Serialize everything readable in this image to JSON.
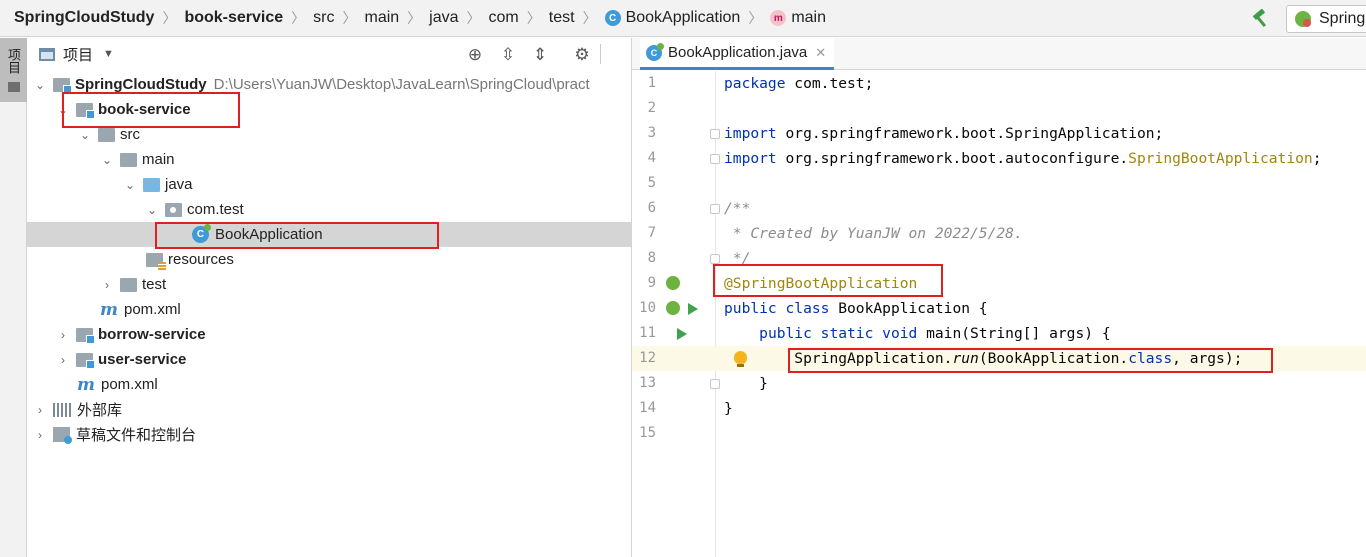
{
  "breadcrumb": {
    "items": [
      "SpringCloudStudy",
      "book-service",
      "src",
      "main",
      "java",
      "com",
      "test",
      "BookApplication",
      "main"
    ],
    "class_badge": "C",
    "method_badge": "m"
  },
  "toolbar": {
    "run_config_label": "Spring"
  },
  "tool_strip": {
    "project_tab": "项目"
  },
  "project_panel": {
    "title": "项目",
    "tree": {
      "root_label": "SpringCloudStudy",
      "root_path": "D:\\Users\\YuanJW\\Desktop\\JavaLearn\\SpringCloud\\pract",
      "book_service": "book-service",
      "src": "src",
      "main": "main",
      "java": "java",
      "com_test": "com.test",
      "book_application": "BookApplication",
      "resources": "resources",
      "test": "test",
      "pom_book": "pom.xml",
      "borrow_service": "borrow-service",
      "user_service": "user-service",
      "pom_root": "pom.xml",
      "external_libs": "外部库",
      "scratches": "草稿文件和控制台",
      "maven_badge": "m"
    }
  },
  "editor": {
    "tab_label": "BookApplication.java",
    "line_numbers": [
      "1",
      "2",
      "3",
      "4",
      "5",
      "6",
      "7",
      "8",
      "9",
      "10",
      "11",
      "12",
      "13",
      "14",
      "15"
    ],
    "code": {
      "l1_kw": "package",
      "l1_rest": " com.test;",
      "l3_kw": "import",
      "l3_rest": " org.springframework.boot.SpringApplication;",
      "l4_kw": "import",
      "l4_rest": " org.springframework.boot.autoconfigure.",
      "l4_ann": "SpringBootApplication",
      "l4_end": ";",
      "l6": "/**",
      "l7": " * Created by YuanJW on 2022/5/28.",
      "l8": " */",
      "l9": "@SpringBootApplication",
      "l10_kw": "public class",
      "l10_rest": " BookApplication {",
      "l11_indent": "    ",
      "l11_kw": "public static void",
      "l11_rest": " main(String[] args) {",
      "l12_indent": "        ",
      "l12_a": "SpringApplication.",
      "l12_run": "run",
      "l12_b": "(BookApplication.",
      "l12_class": "class",
      "l12_c": ", args);",
      "l13": "    }",
      "l14": "}"
    }
  },
  "colors": {
    "keyword": "#0033b3",
    "annotation": "#9e880d",
    "comment": "#8c8c8c",
    "highlight_box": "#e02020",
    "selection": "#d5d5d5"
  }
}
